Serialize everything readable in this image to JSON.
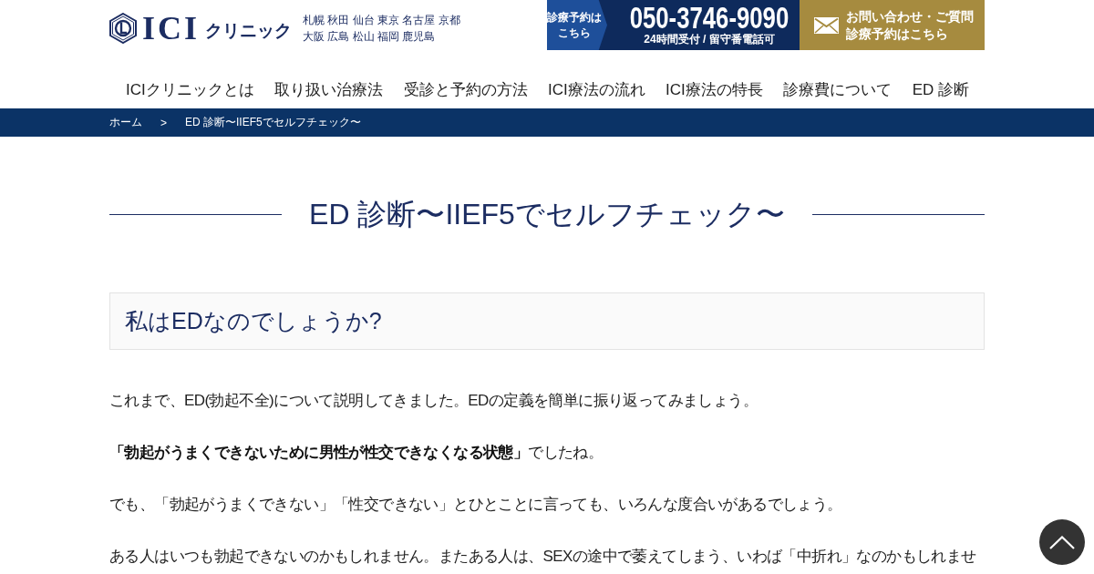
{
  "header": {
    "logo": {
      "wordmark": "ICI",
      "subtitle": "クリニック"
    },
    "locations": [
      "札幌 秋田 仙台 東京 名古屋 京都",
      "大阪 広島 松山 福岡 鹿児島"
    ]
  },
  "contact": {
    "reserve_label": [
      "診療予約は",
      "こちら"
    ],
    "phone": "050-3746-9090",
    "phone_note": "24時間受付 / 留守番電話可",
    "inquiry_label": [
      "お問い合わせ・ご質問",
      "診療予約はこちら"
    ]
  },
  "nav": [
    "ICIクリニックとは",
    "取り扱い治療法",
    "受診と予約の方法",
    "ICI療法の流れ",
    "ICI療法の特長",
    "診療費について",
    "ED 診断"
  ],
  "breadcrumb": {
    "links": [
      "ホーム"
    ],
    "separator": ">",
    "current": "ED 診断〜IIEF5でセルフチェック〜"
  },
  "page_title": "ED 診断〜IIEF5でセルフチェック〜",
  "section_heading": "私はEDなのでしょうか?",
  "paragraphs": [
    "これまで、ED(勃起不全)について説明してきました。EDの定義を簡単に振り返ってみましょう。",
    "**「勃起がうまくできないために男性が性交できなくなる状態」**でしたね。",
    "でも、「勃起がうまくできない」「性交できない」とひとことに言っても、いろんな度合いがあるでしょう。",
    "ある人はいつも勃起できないのかもしれません。またある人は、SEXの途中で萎えてしまう、いわば「中折れ」なのかもしれませ"
  ]
}
